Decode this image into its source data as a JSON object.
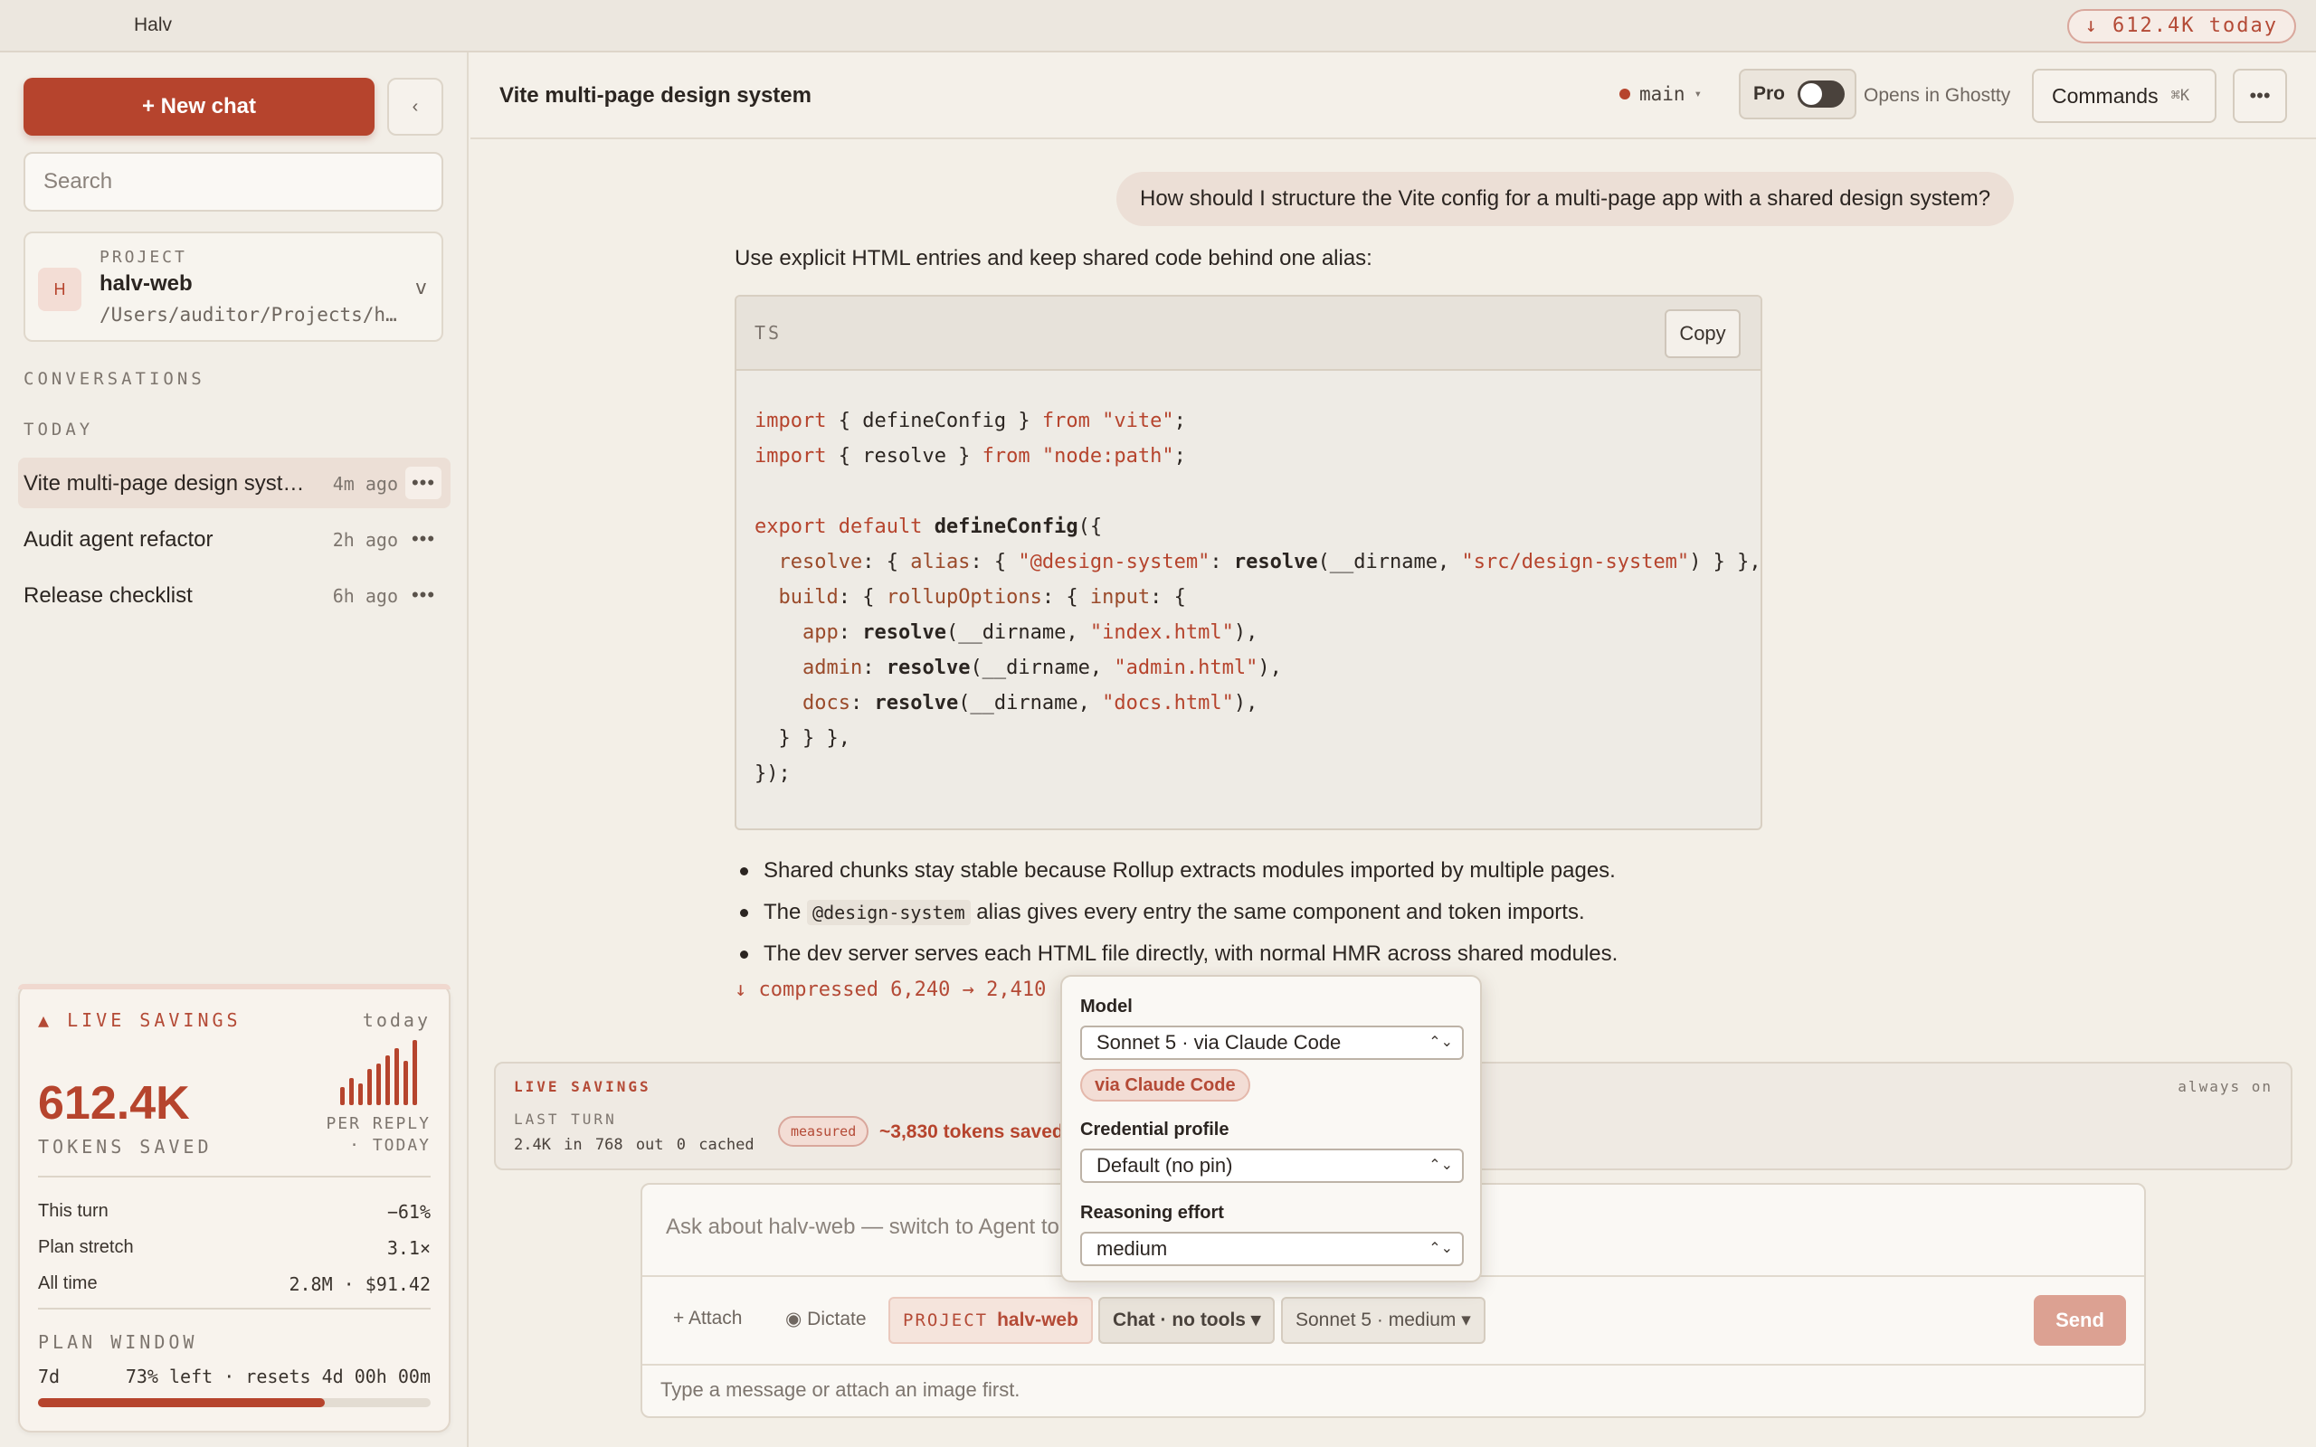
{
  "window": {
    "app_title": "Halv",
    "today_savings": "↓ 612.4K today"
  },
  "sidebar": {
    "new_chat_label": "+ New chat",
    "collapse_icon": "‹",
    "search_placeholder": "Search",
    "project": {
      "eyebrow": "PROJECT",
      "avatar": "H",
      "name": "halv-web",
      "path": "/Users/auditor/Projects/h…",
      "chevron": "v"
    },
    "conversations_label": "CONVERSATIONS",
    "today_label": "TODAY",
    "conversations": [
      {
        "title": "Vite multi-page design syst…",
        "time": "4m ago",
        "active": true
      },
      {
        "title": "Audit agent refactor",
        "time": "2h ago",
        "active": false
      },
      {
        "title": "Release checklist",
        "time": "6h ago",
        "active": false
      }
    ],
    "more_icon": "•••",
    "savings": {
      "title": "▲ LIVE SAVINGS",
      "period": "today",
      "big_value": "612.4K",
      "big_label": "TOKENS SAVED",
      "per_reply_label": "PER REPLY",
      "per_reply_sub": "· TODAY",
      "bar_levels": [
        0.28,
        0.42,
        0.34,
        0.56,
        0.64,
        0.76,
        0.88,
        0.68,
        1.0
      ],
      "rows": [
        {
          "label": "This turn",
          "value": "−61%"
        },
        {
          "label": "Plan stretch",
          "value": "3.1×"
        },
        {
          "label": "All time",
          "value": "2.8M · $91.42"
        }
      ],
      "plan_label": "PLAN WINDOW",
      "plan_period": "7d",
      "plan_status": "73% left · resets 4d 00h 00m",
      "plan_used_fraction": 0.73
    }
  },
  "header": {
    "chat_title": "Vite multi-page design system",
    "branch": "main",
    "branch_chevron": "▾",
    "pro_label": "Pro",
    "opens_in": "Opens in Ghostty",
    "commands_label": "Commands",
    "commands_shortcut": "⌘K",
    "more_icon": "•••"
  },
  "conversation": {
    "user_message": "How should I structure the Vite config for a multi-page app with a shared design system?",
    "answer_intro": "Use explicit HTML entries and keep shared code behind one alias:",
    "code": {
      "lang": "TS",
      "copy_label": "Copy"
    },
    "bullets": {
      "b1": "Shared chunks stay stable because Rollup extracts modules imported by multiple pages.",
      "b2_pre": "The ",
      "b2_code": "@design-system",
      "b2_post": " alias gives every entry the same component and token imports.",
      "b3": "The dev server serves each HTML file directly, with normal HMR across shared modules."
    },
    "compressed_note": "↓ compressed 6,240 → 2,410"
  },
  "live_panel": {
    "title": "LIVE SAVINGS",
    "always_on": "always on",
    "last_turn_label": "LAST TURN",
    "stats": "2.4K in  768 out  0 cached",
    "badge": "measured",
    "saved": "~3,830 tokens saved"
  },
  "composer": {
    "placeholder": "Ask about halv-web — switch to Agent to let Claude make changes",
    "attach": "+ Attach",
    "dictate": "◉ Dictate",
    "project_chip_label": "PROJECT",
    "project_chip_value": "halv-web",
    "mode_chip": "Chat · no tools ▾",
    "model_chip": "Sonnet 5 · medium ▾",
    "send": "Send",
    "hint": "Type a message or attach an image first."
  },
  "model_popover": {
    "model_label": "Model",
    "model_value": "Sonnet 5 · via Claude Code",
    "via_badge": "via Claude Code",
    "credential_label": "Credential profile",
    "credential_value": "Default (no pin)",
    "effort_label": "Reasoning effort",
    "effort_value": "medium",
    "select_chevron": "⌃⌄"
  }
}
